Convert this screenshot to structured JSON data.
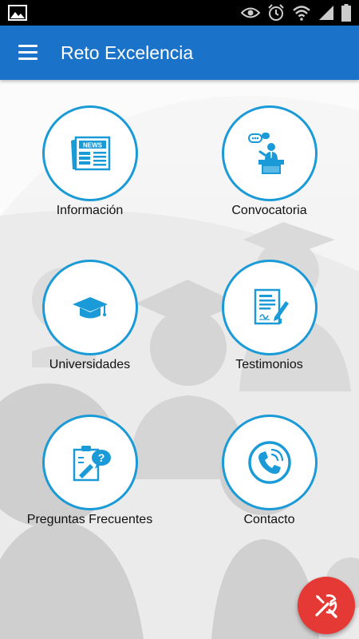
{
  "status_bar": {
    "left_icon": "image-icon",
    "right_icons": [
      "eye-icon",
      "alarm-icon",
      "wifi-icon",
      "signal-icon",
      "battery-icon"
    ]
  },
  "app_bar": {
    "title": "Reto Excelencia",
    "menu_icon": "hamburger-menu-icon",
    "color": "#1a73c8"
  },
  "grid": {
    "items": [
      {
        "label": "Información",
        "icon": "newspaper-icon"
      },
      {
        "label": "Convocatoria",
        "icon": "speaker-podium-icon"
      },
      {
        "label": "Universidades",
        "icon": "graduation-cap-icon"
      },
      {
        "label": "Testimonios",
        "icon": "document-pen-icon"
      },
      {
        "label": "Preguntas Frecuentes",
        "icon": "clipboard-question-icon"
      },
      {
        "label": "Contacto",
        "icon": "phone-icon"
      }
    ],
    "circle_color": "#1a9ad6"
  },
  "fab": {
    "icon": "tools-icon",
    "color": "#e53935"
  }
}
